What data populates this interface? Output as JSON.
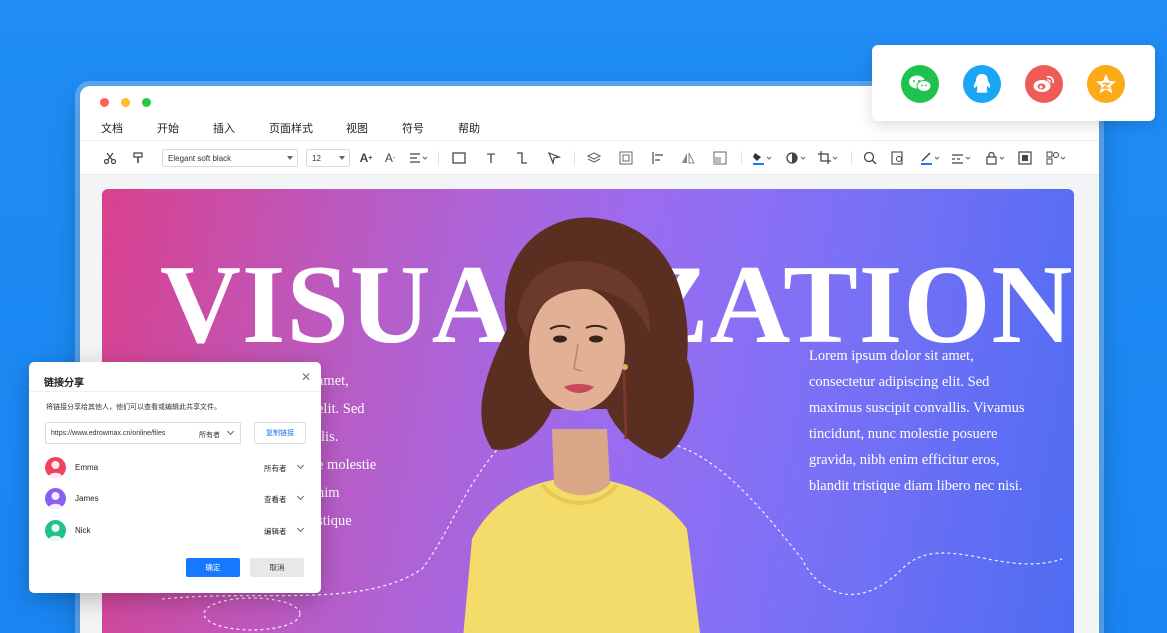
{
  "menu": [
    "文档",
    "开始",
    "插入",
    "页面样式",
    "视图",
    "符号",
    "帮助"
  ],
  "toolbar": {
    "font": "Elegant soft black",
    "size": "12"
  },
  "slide": {
    "title": "VISUALIZATION",
    "body_right": "Lorem ipsum dolor sit amet, consectetur adipiscing elit. Sed maximus suscipit convallis. Vivamus tincidunt, nunc molestie posuere gravida, nibh enim efficitur eros, blandit tristique diam libero nec nisi.",
    "body_left_fragments": [
      "amet,",
      "elit. Sed",
      "llis.",
      "e molestie",
      "nim",
      "stique"
    ]
  },
  "share_icons": [
    "wechat-icon",
    "qq-icon",
    "weibo-icon",
    "qzone-icon"
  ],
  "share_colors": {
    "wechat": "#1fc14f",
    "qq": "#1aa5f5",
    "weibo": "#ef5b57",
    "qzone": "#fcaa17"
  },
  "dialog": {
    "title": "链接分享",
    "description": "将链接分享给其他人，他们可以查看或编辑此共享文件。",
    "link_url": "https://www.edrowmax.cn/online/files",
    "link_permission": "所有者",
    "copy_label": "复制链接",
    "users": [
      {
        "name": "Emma",
        "role": "所有者",
        "color": "#f0445e"
      },
      {
        "name": "James",
        "role": "查看者",
        "color": "#8b5cf6"
      },
      {
        "name": "Nick",
        "role": "编辑者",
        "color": "#22c08f"
      }
    ],
    "ok_label": "确定",
    "cancel_label": "取消"
  }
}
